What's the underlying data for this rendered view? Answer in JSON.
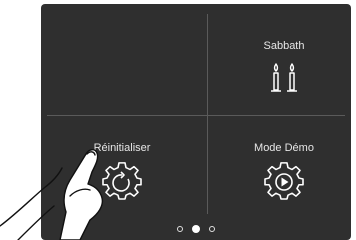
{
  "tiles": [
    {
      "id": "sabbath",
      "label": "Sabbath",
      "icon": "candles-icon"
    },
    {
      "id": "reset",
      "label": "Réinitialiser",
      "icon": "gear-reset-icon"
    },
    {
      "id": "demo",
      "label": "Mode Démo",
      "icon": "gear-play-icon"
    }
  ],
  "pagination": {
    "total": 3,
    "active_index": 1
  },
  "colors": {
    "panel": "#2f2f2f",
    "divider": "#5a5a5a",
    "text": "#e6e6e6",
    "icon": "#ffffff"
  }
}
